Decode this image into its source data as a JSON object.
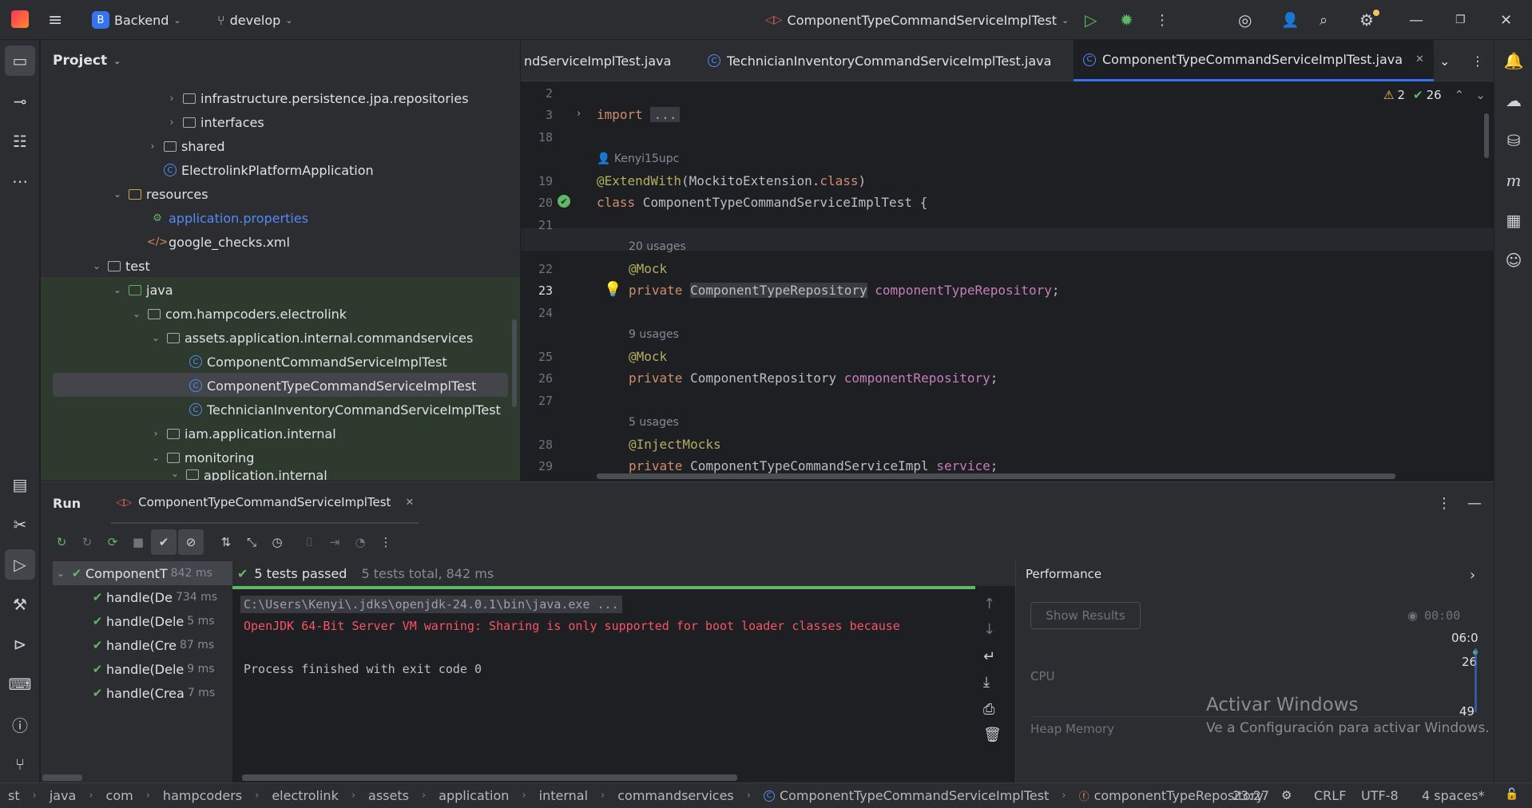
{
  "titlebar": {
    "project_letter": "B",
    "project_name": "Backend",
    "branch": "develop",
    "run_config": "ComponentTypeCommandServiceImplTest"
  },
  "project_panel": {
    "title": "Project",
    "tree": [
      {
        "label": "infrastructure.persistence.jpa.repositories",
        "type": "folder",
        "expanded": false
      },
      {
        "label": "interfaces",
        "type": "folder",
        "expanded": false
      },
      {
        "label": "shared",
        "type": "folder",
        "expanded": false
      },
      {
        "label": "ElectrolinkPlatformApplication",
        "type": "class"
      },
      {
        "label": "resources",
        "type": "folder",
        "expanded": true
      },
      {
        "label": "application.properties",
        "type": "properties"
      },
      {
        "label": "google_checks.xml",
        "type": "xml"
      },
      {
        "label": "test",
        "type": "folder",
        "expanded": true
      },
      {
        "label": "java",
        "type": "folder",
        "expanded": true
      },
      {
        "label": "com.hampcoders.electrolink",
        "type": "folder",
        "expanded": true
      },
      {
        "label": "assets.application.internal.commandservices",
        "type": "folder",
        "expanded": true
      },
      {
        "label": "ComponentCommandServiceImplTest",
        "type": "test"
      },
      {
        "label": "ComponentTypeCommandServiceImplTest",
        "type": "test",
        "selected": true
      },
      {
        "label": "TechnicianInventoryCommandServiceImplTest",
        "type": "test"
      },
      {
        "label": "iam.application.internal",
        "type": "folder",
        "expanded": false
      },
      {
        "label": "monitoring",
        "type": "folder",
        "expanded": true
      },
      {
        "label": "application.internal",
        "type": "folder",
        "expanded": true
      }
    ]
  },
  "editor": {
    "tabs": [
      {
        "label": "ndServiceImplTest.java",
        "active": false
      },
      {
        "label": "TechnicianInventoryCommandServiceImplTest.java",
        "active": false
      },
      {
        "label": "ComponentTypeCommandServiceImplTest.java",
        "active": true
      }
    ],
    "warnings": "2",
    "checks": "26",
    "author_hint": "Kenyi15upc",
    "lines": {
      "n2": "2",
      "n3": "3",
      "n18": "18",
      "n19": "19",
      "n20": "20",
      "n21": "21",
      "n22": "22",
      "n23": "23",
      "n24": "24",
      "n25": "25",
      "n26": "26",
      "n27": "27",
      "n28": "28",
      "n29": "29"
    },
    "code": {
      "import_kw": "import",
      "import_fold": "...",
      "ann_extend": "@ExtendWith",
      "extend_args": "(MockitoExtension.",
      "extend_class_kw": "class",
      "extend_close": ")",
      "class_kw": "class",
      "class_name": " ComponentTypeCommandServiceImplTest {",
      "usages1": "20 usages",
      "ann_mock1": "@Mock",
      "private1": "private",
      "type1": "ComponentTypeRepository",
      "field1": "componentTypeRepository",
      "semi": ";",
      "usages2": "9 usages",
      "ann_mock2": "@Mock",
      "private2": "private",
      "type2": " ComponentRepository ",
      "field2": "componentRepository",
      "usages3": "5 usages",
      "ann_inject": "@InjectMocks",
      "private3": "private",
      "type3": " ComponentTypeCommandServiceImpl ",
      "field3": "service"
    }
  },
  "run_panel": {
    "title": "Run",
    "tab_label": "ComponentTypeCommandServiceImplTest",
    "status_passed": "5 tests passed",
    "status_total": "5 tests total, 842 ms",
    "tests": [
      {
        "label": "ComponentT",
        "time": "842 ms",
        "root": true
      },
      {
        "label": "handle(De",
        "time": "734 ms"
      },
      {
        "label": "handle(Dele",
        "time": "5 ms"
      },
      {
        "label": "handle(Cre",
        "time": "87 ms"
      },
      {
        "label": "handle(Dele",
        "time": "9 ms"
      },
      {
        "label": "handle(Crea",
        "time": "7 ms"
      }
    ],
    "console": {
      "cmd": "C:\\Users\\Kenyi\\.jdks\\openjdk-24.0.1\\bin\\java.exe ...",
      "warning": "OpenJDK 64-Bit Server VM warning: Sharing is only supported for boot loader classes because",
      "finished": "Process finished with exit code 0"
    },
    "performance": {
      "title": "Performance",
      "show_results": "Show Results",
      "timer": "00:00",
      "time_label": "06:0",
      "cpu_label": "CPU",
      "cpu_value": "26",
      "heap_label": "Heap Memory",
      "heap_value": "49"
    }
  },
  "watermark": {
    "title": "Activar Windows",
    "subtitle": "Ve a Configuración para activar Windows."
  },
  "statusbar": {
    "crumbs": [
      "st",
      "java",
      "com",
      "hampcoders",
      "electrolink",
      "assets",
      "application",
      "internal",
      "commandservices",
      "ComponentTypeCommandServiceImplTest",
      "componentTypeRepository"
    ],
    "position": "23:27",
    "line_ending": "CRLF",
    "encoding": "UTF-8",
    "indent": "4 spaces*"
  }
}
